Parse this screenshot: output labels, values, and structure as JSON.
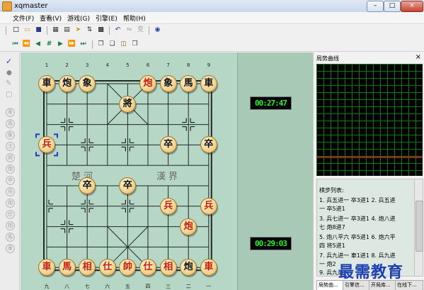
{
  "window": {
    "title": "xqmaster"
  },
  "menu": [
    "文件(F)",
    "查看(V)",
    "游戏(G)",
    "引擎(E)",
    "帮助(H)"
  ],
  "board": {
    "top_ranks": [
      "1",
      "2",
      "3",
      "4",
      "5",
      "6",
      "7",
      "8",
      "9"
    ],
    "bottom_ranks": [
      "九",
      "八",
      "七",
      "六",
      "五",
      "四",
      "三",
      "二",
      "一"
    ],
    "river_left": "楚河",
    "river_right": "漢界",
    "pieces": [
      {
        "col": 0,
        "row": 0,
        "ch": "車",
        "side": "black"
      },
      {
        "col": 1,
        "row": 0,
        "ch": "炮",
        "side": "black"
      },
      {
        "col": 2,
        "row": 0,
        "ch": "象",
        "side": "black"
      },
      {
        "col": 5,
        "row": 0,
        "ch": "炮",
        "side": "red"
      },
      {
        "col": 6,
        "row": 0,
        "ch": "象",
        "side": "black"
      },
      {
        "col": 7,
        "row": 0,
        "ch": "馬",
        "side": "black"
      },
      {
        "col": 8,
        "row": 0,
        "ch": "車",
        "side": "black"
      },
      {
        "col": 4,
        "row": 1,
        "ch": "將",
        "side": "black"
      },
      {
        "col": 0,
        "row": 3,
        "ch": "兵",
        "side": "red"
      },
      {
        "col": 6,
        "row": 3,
        "ch": "卒",
        "side": "black"
      },
      {
        "col": 8,
        "row": 3,
        "ch": "卒",
        "side": "black"
      },
      {
        "col": 2,
        "row": 5,
        "ch": "卒",
        "side": "black"
      },
      {
        "col": 4,
        "row": 5,
        "ch": "卒",
        "side": "black"
      },
      {
        "col": 6,
        "row": 6,
        "ch": "兵",
        "side": "red"
      },
      {
        "col": 8,
        "row": 6,
        "ch": "兵",
        "side": "red"
      },
      {
        "col": 7,
        "row": 7,
        "ch": "炮",
        "side": "red"
      },
      {
        "col": 0,
        "row": 9,
        "ch": "車",
        "side": "red"
      },
      {
        "col": 1,
        "row": 9,
        "ch": "馬",
        "side": "red"
      },
      {
        "col": 2,
        "row": 9,
        "ch": "相",
        "side": "red"
      },
      {
        "col": 3,
        "row": 9,
        "ch": "仕",
        "side": "red"
      },
      {
        "col": 4,
        "row": 9,
        "ch": "帥",
        "side": "red"
      },
      {
        "col": 5,
        "row": 9,
        "ch": "仕",
        "side": "red"
      },
      {
        "col": 6,
        "row": 9,
        "ch": "相",
        "side": "red"
      },
      {
        "col": 7,
        "row": 9,
        "ch": "炮",
        "side": "black"
      },
      {
        "col": 8,
        "row": 9,
        "ch": "車",
        "side": "red"
      }
    ],
    "selected": {
      "col": 0,
      "row": 3
    }
  },
  "timers": {
    "top": "00:27:47",
    "bottom": "00:29:03"
  },
  "panel": {
    "title": "局势曲线",
    "close": "×",
    "movelist_header": "棋步列表:",
    "moves": [
      "1. 兵五进一 卒3进1 2. 兵五进",
      "一 卒5进1",
      "3. 兵七进一 卒3进1 4. 炮八进",
      "七 炮8进7",
      "5. 炮八平六 卒5进1 6. 炮六平",
      "四 将5进1",
      "7. 兵九进一 車1进1 8. 兵九进",
      "一 炮2",
      "9. 兵九进一"
    ],
    "tabs": [
      "局势曲...",
      "引擎信...",
      "开局库...",
      "在线下..."
    ]
  },
  "watermark": "最需教育",
  "colors": {
    "board": "#b6d6c6",
    "timer_text": "#2cf02c",
    "red_piece": "#c41e0c",
    "curve_grid": "#0a7a0a",
    "curve_line": "#e02020"
  }
}
